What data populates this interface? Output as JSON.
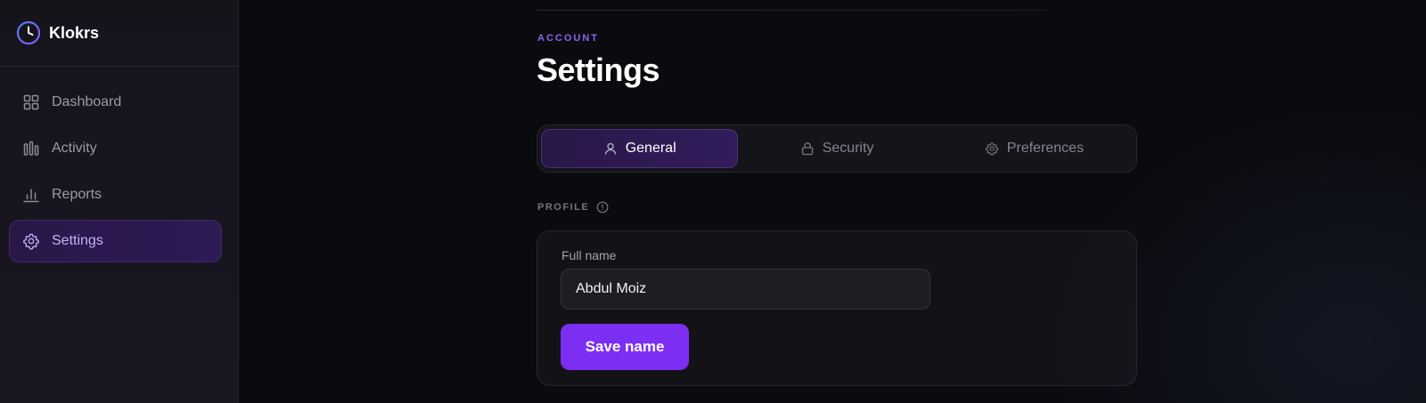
{
  "brand": {
    "name": "Klokrs"
  },
  "sidebar": {
    "items": [
      {
        "label": "Dashboard",
        "icon": "grid-icon",
        "active": false
      },
      {
        "label": "Activity",
        "icon": "activity-bars-icon",
        "active": false
      },
      {
        "label": "Reports",
        "icon": "bar-chart-icon",
        "active": false
      },
      {
        "label": "Settings",
        "icon": "gear-icon",
        "active": true
      }
    ]
  },
  "header": {
    "eyebrow": "ACCOUNT",
    "title": "Settings"
  },
  "tabs": [
    {
      "label": "General",
      "icon": "user-icon",
      "active": true
    },
    {
      "label": "Security",
      "icon": "lock-icon",
      "active": false
    },
    {
      "label": "Preferences",
      "icon": "gear-icon",
      "active": false
    }
  ],
  "profile": {
    "section_label": "PROFILE",
    "full_name_label": "Full name",
    "full_name_value": "Abdul Moiz",
    "save_label": "Save name"
  },
  "colors": {
    "accent": "#7c2ff2",
    "eyebrow": "#8a63f0",
    "active_bg": "#2a1748",
    "background": "#0b0b0f"
  }
}
